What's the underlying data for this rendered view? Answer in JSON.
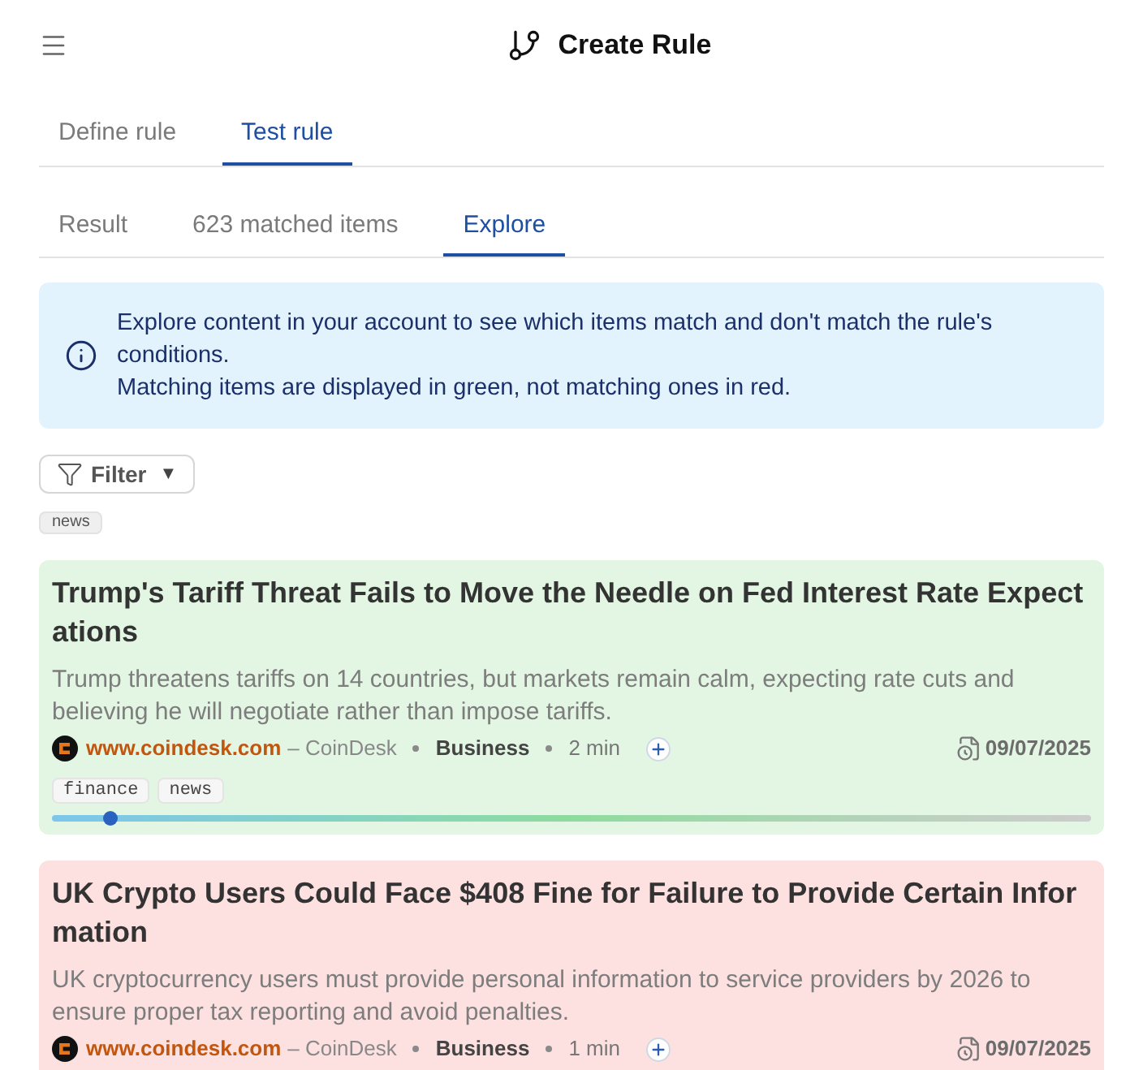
{
  "header": {
    "title": "Create Rule"
  },
  "tabs": [
    {
      "label": "Define rule",
      "selected": false
    },
    {
      "label": "Test rule",
      "selected": true
    }
  ],
  "subtabs": [
    {
      "label": "Result",
      "selected": false
    },
    {
      "label": "623 matched items",
      "selected": false
    },
    {
      "label": "Explore",
      "selected": true
    }
  ],
  "info": {
    "paragraphs": [
      "Explore content in your account to see which items match and don't match the rule's conditions.",
      "Matching items are displayed in green, not matching ones in red."
    ]
  },
  "filter": {
    "label": "Filter",
    "caret": "▼",
    "tags": [
      "news"
    ]
  },
  "items": [
    {
      "matched": true,
      "title": "Trump's Tariff Threat Fails to Move the Needle on Fed Interest Rate Expectations",
      "description": "Trump threatens tariffs on 14 countries, but markets remain calm, expecting rate cuts and believing he will negotiate rather than impose tariffs.",
      "domain": "www.coindesk.com",
      "source": "– CoinDesk",
      "category": "Business",
      "read_time": "2 min",
      "date": "09/07/2025",
      "tags": [
        "finance",
        "news"
      ],
      "level": 0.056
    },
    {
      "matched": false,
      "title": "UK Crypto Users Could Face $408 Fine for Failure to Provide Certain Information",
      "description": "UK cryptocurrency users must provide personal information to service providers by 2026 to ensure proper tax reporting and avoid penalties.",
      "domain": "www.coindesk.com",
      "source": "– CoinDesk",
      "category": "Business",
      "read_time": "1 min",
      "date": "09/07/2025"
    }
  ]
}
